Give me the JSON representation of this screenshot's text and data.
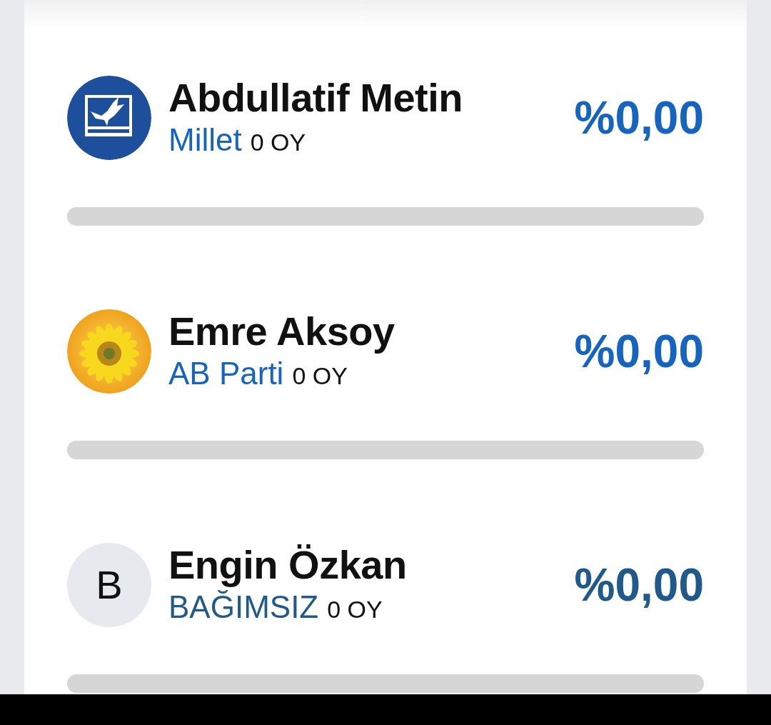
{
  "candidates": [
    {
      "name": "Abdullatif Metin",
      "party": "Millet",
      "votes": "0 OY",
      "percent": "%0,00",
      "level": 0,
      "color": "#1565c0",
      "logo": {
        "kind": "eagle"
      }
    },
    {
      "name": "Emre Aksoy",
      "party": "AB Parti",
      "votes": "0 OY",
      "percent": "%0,00",
      "level": 0,
      "color": "#1565c0",
      "logo": {
        "kind": "sunflower"
      }
    },
    {
      "name": "Engin Özkan",
      "party": "BAĞIMSIZ",
      "votes": "0 OY",
      "percent": "%0,00",
      "level": 0,
      "color": "#1f5a8a",
      "logo": {
        "kind": "initial",
        "text": "B"
      }
    }
  ]
}
